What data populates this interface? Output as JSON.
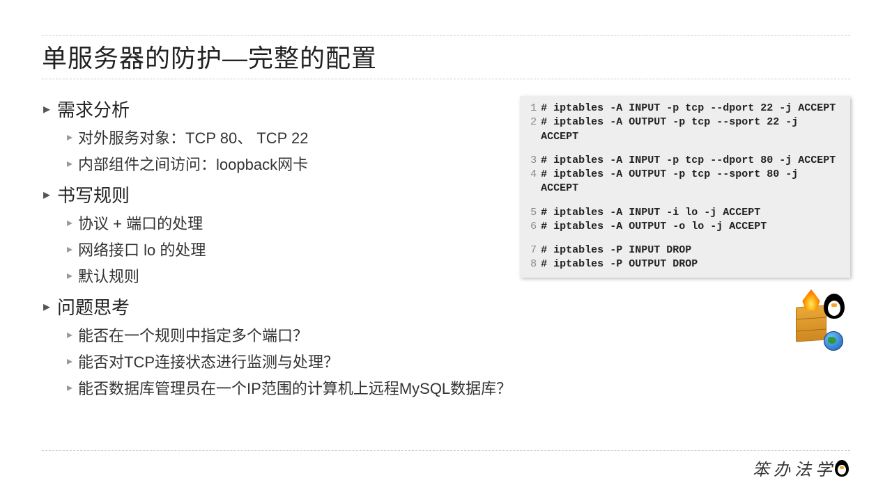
{
  "title": "单服务器的防护—完整的配置",
  "sections": [
    {
      "heading": "需求分析",
      "items": [
        "对外服务对象：TCP 80、 TCP 22",
        "内部组件之间访问：loopback网卡"
      ]
    },
    {
      "heading": "书写规则",
      "items": [
        "协议 + 端口的处理",
        "网络接口 lo 的处理",
        "默认规则"
      ]
    },
    {
      "heading": "问题思考",
      "items": [
        "能否在一个规则中指定多个端口？",
        "能否对TCP连接状态进行监测与处理？",
        "能否数据库管理员在一个IP范围的计算机上远程MySQL数据库？"
      ]
    }
  ],
  "code": {
    "lines": [
      {
        "n": "1",
        "t": "# iptables -A INPUT -p tcp --dport 22 -j ACCEPT"
      },
      {
        "n": "2",
        "t": "# iptables -A OUTPUT -p tcp --sport 22 -j ACCEPT"
      },
      {
        "n": "",
        "t": ""
      },
      {
        "n": "3",
        "t": "# iptables -A INPUT -p tcp --dport 80 -j ACCEPT"
      },
      {
        "n": "4",
        "t": "# iptables -A OUTPUT -p tcp --sport 80 -j ACCEPT"
      },
      {
        "n": "",
        "t": ""
      },
      {
        "n": "5",
        "t": "# iptables -A INPUT -i lo -j ACCEPT"
      },
      {
        "n": "6",
        "t": "# iptables -A OUTPUT -o lo -j ACCEPT"
      },
      {
        "n": "",
        "t": ""
      },
      {
        "n": "7",
        "t": "# iptables -P INPUT DROP"
      },
      {
        "n": "8",
        "t": "# iptables -P OUTPUT DROP"
      }
    ]
  },
  "brand": "笨 办 法 学"
}
